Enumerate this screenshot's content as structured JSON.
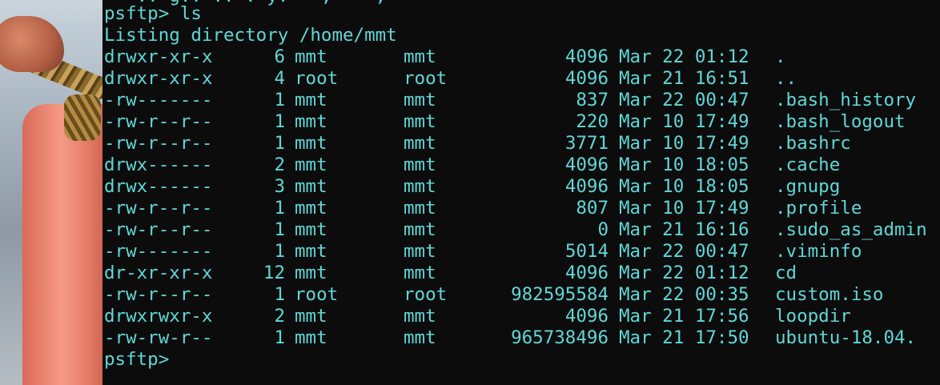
{
  "terminal": {
    "top_partial": "   .. g.. .. . y.   ,    ,",
    "command_prompt": "psftp> ",
    "command": "ls",
    "listing_header": "Listing directory /home/mmt",
    "entries": [
      {
        "perms": "drwxr-xr-x",
        "links": "6",
        "owner": "mmt",
        "group": "mmt",
        "size": "4096",
        "date": "Mar 22 01:12",
        "name": "."
      },
      {
        "perms": "drwxr-xr-x",
        "links": "4",
        "owner": "root",
        "group": "root",
        "size": "4096",
        "date": "Mar 21 16:51",
        "name": ".."
      },
      {
        "perms": "-rw-------",
        "links": "1",
        "owner": "mmt",
        "group": "mmt",
        "size": "837",
        "date": "Mar 22 00:47",
        "name": ".bash_history"
      },
      {
        "perms": "-rw-r--r--",
        "links": "1",
        "owner": "mmt",
        "group": "mmt",
        "size": "220",
        "date": "Mar 10 17:49",
        "name": ".bash_logout"
      },
      {
        "perms": "-rw-r--r--",
        "links": "1",
        "owner": "mmt",
        "group": "mmt",
        "size": "3771",
        "date": "Mar 10 17:49",
        "name": ".bashrc"
      },
      {
        "perms": "drwx------",
        "links": "2",
        "owner": "mmt",
        "group": "mmt",
        "size": "4096",
        "date": "Mar 10 18:05",
        "name": ".cache"
      },
      {
        "perms": "drwx------",
        "links": "3",
        "owner": "mmt",
        "group": "mmt",
        "size": "4096",
        "date": "Mar 10 18:05",
        "name": ".gnupg"
      },
      {
        "perms": "-rw-r--r--",
        "links": "1",
        "owner": "mmt",
        "group": "mmt",
        "size": "807",
        "date": "Mar 10 17:49",
        "name": ".profile"
      },
      {
        "perms": "-rw-r--r--",
        "links": "1",
        "owner": "mmt",
        "group": "mmt",
        "size": "0",
        "date": "Mar 21 16:16",
        "name": ".sudo_as_admin"
      },
      {
        "perms": "-rw-------",
        "links": "1",
        "owner": "mmt",
        "group": "mmt",
        "size": "5014",
        "date": "Mar 22 00:47",
        "name": ".viminfo"
      },
      {
        "perms": "dr-xr-xr-x",
        "links": "12",
        "owner": "mmt",
        "group": "mmt",
        "size": "4096",
        "date": "Mar 22 01:12",
        "name": "cd"
      },
      {
        "perms": "-rw-r--r--",
        "links": "1",
        "owner": "root",
        "group": "root",
        "size": "982595584",
        "date": "Mar 22 00:35",
        "name": "custom.iso"
      },
      {
        "perms": "drwxrwxr-x",
        "links": "2",
        "owner": "mmt",
        "group": "mmt",
        "size": "4096",
        "date": "Mar 21 17:56",
        "name": "loopdir"
      },
      {
        "perms": "-rw-rw-r--",
        "links": "1",
        "owner": "mmt",
        "group": "mmt",
        "size": "965738496",
        "date": "Mar 21 17:50",
        "name": "ubuntu-18.04."
      }
    ],
    "final_prompt": "psftp>",
    "text_color": "#61d6d6",
    "background_color": "#0c0c0c"
  }
}
